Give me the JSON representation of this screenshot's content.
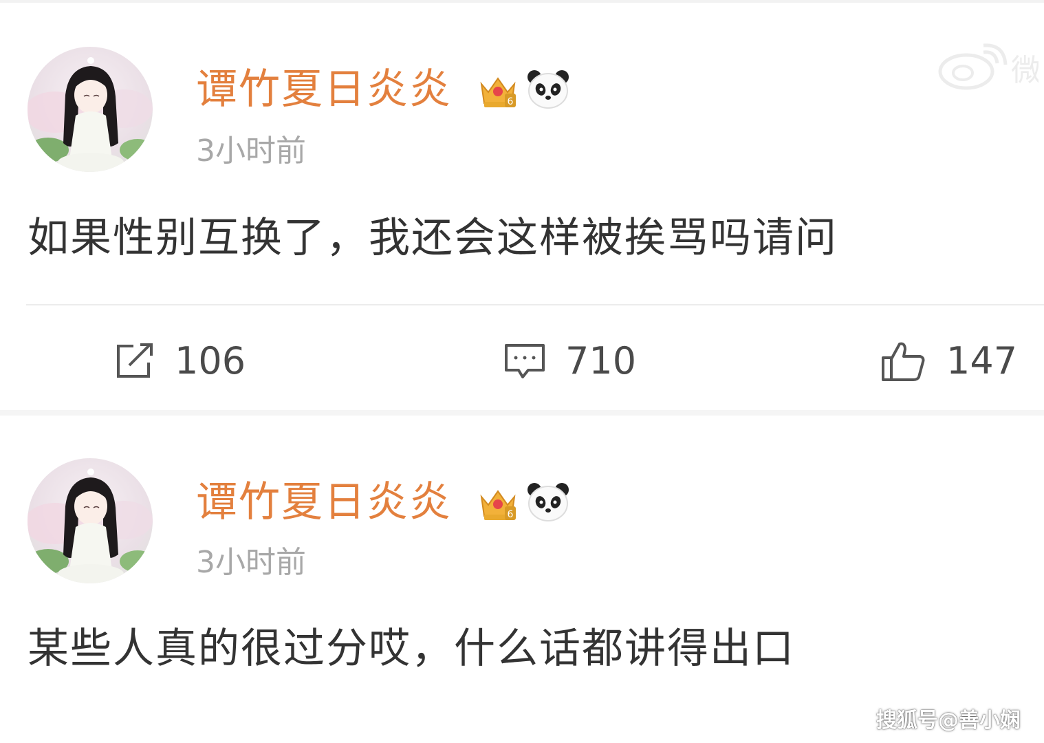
{
  "posts": [
    {
      "username": "谭竹夏日炎炎",
      "time": "3小时前",
      "content": "如果性别互换了，我还会这样被挨骂吗请问",
      "actions": {
        "repost_count": "106",
        "comment_count": "710",
        "like_count": "147"
      }
    },
    {
      "username": "谭竹夏日炎炎",
      "time": "3小时前",
      "content": "某些人真的很过分哎，什么话都讲得出口"
    }
  ],
  "badges": {
    "crown_level": "6"
  },
  "watermark": {
    "source": "搜狐号@善小娴"
  },
  "colors": {
    "username": "#e3803e",
    "time": "#a8a8a8",
    "content": "#333333",
    "action_icon": "#555555"
  }
}
